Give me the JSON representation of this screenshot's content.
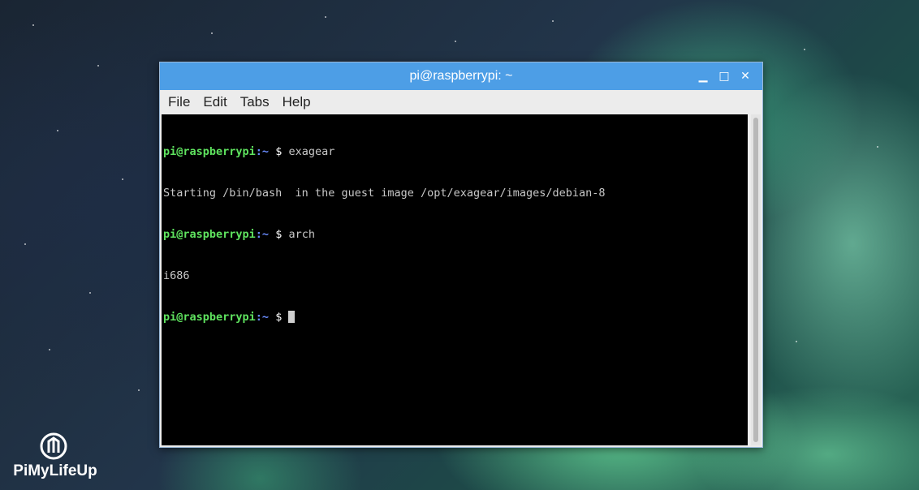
{
  "window": {
    "title": "pi@raspberrypi: ~",
    "controls": {
      "minimize": "▁",
      "maximize": "□",
      "close": "✕"
    }
  },
  "menu": {
    "items": [
      "File",
      "Edit",
      "Tabs",
      "Help"
    ]
  },
  "terminal": {
    "lines": [
      {
        "type": "prompt",
        "user": "pi@raspberrypi",
        "path": ":~",
        "sign": " $ ",
        "cmd": "exagear"
      },
      {
        "type": "output",
        "text": "Starting /bin/bash  in the guest image /opt/exagear/images/debian-8"
      },
      {
        "type": "prompt",
        "user": "pi@raspberrypi",
        "path": ":~",
        "sign": " $ ",
        "cmd": "arch"
      },
      {
        "type": "output",
        "text": "i686"
      },
      {
        "type": "prompt",
        "user": "pi@raspberrypi",
        "path": ":~",
        "sign": " $ ",
        "cmd": ""
      }
    ]
  },
  "watermark": {
    "text": "PiMyLifeUp"
  },
  "colors": {
    "titlebar": "#4d9ee6",
    "prompt_user": "#5fe35f",
    "prompt_path": "#6a8cff"
  }
}
